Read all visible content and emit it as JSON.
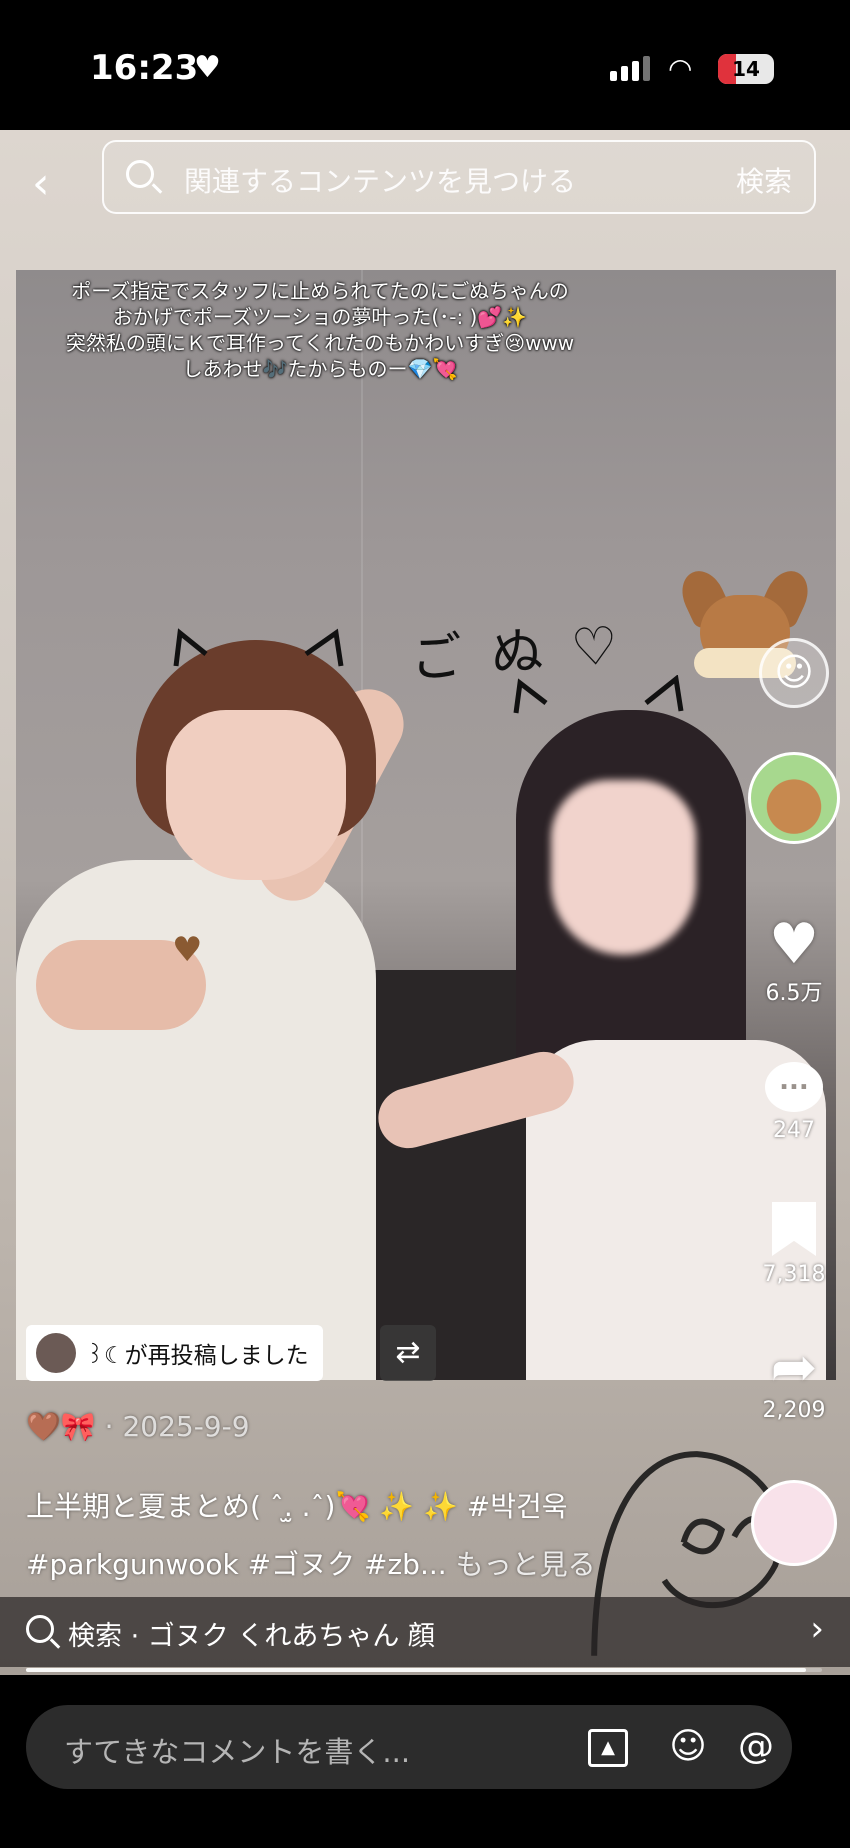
{
  "status_bar": {
    "time": "16:23",
    "heart": "♥",
    "battery": "14"
  },
  "search": {
    "placeholder": "関連するコンテンツを見つける",
    "button": "検索"
  },
  "video": {
    "caption_lines": [
      "ポーズ指定でスタッフに止められてたのにごぬちゃんの",
      "おかげでポーズツーショの夢叶った(･-: )💕✨",
      "突然私の頭にＫで耳作ってくれたのもかわいすぎ😢www",
      "しあわせ🎶たからものー💎💘"
    ],
    "handwriting": "ご ぬ ♡"
  },
  "rail": {
    "likes": "6.5万",
    "comments": "247",
    "saves": "7,318",
    "shares": "2,209"
  },
  "repost": {
    "text": "꒱☾が再投稿しました"
  },
  "post": {
    "emoji": "🤎🎀",
    "date": "· 2025-9-9",
    "desc_line1": "上半期と夏まとめ( ˆ.̫ .ˆ)💘 ✨ ✨ #박건욱",
    "desc_line2": "#parkgunwook #ゴヌク #zb...",
    "more": "もっと見る"
  },
  "related_search": {
    "text": "検索 · ゴヌク くれあちゃん 顔"
  },
  "progress": 0.98,
  "comment_bar": {
    "placeholder": "すてきなコメントを書く..."
  },
  "icons": [
    "search-icon",
    "back-icon",
    "heart-icon",
    "comment-icon",
    "bookmark-icon",
    "share-icon",
    "image-icon",
    "emoji-icon",
    "mention-icon",
    "repost-icon",
    "chevron-right-icon"
  ]
}
